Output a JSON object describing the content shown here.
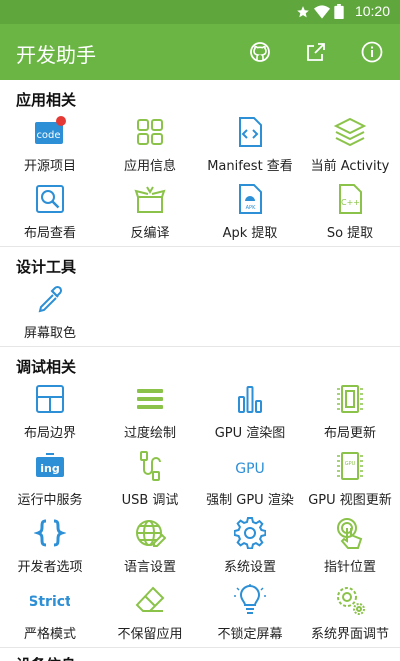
{
  "status": {
    "time": "10:20"
  },
  "app": {
    "title": "开发助手"
  },
  "sections": {
    "app_related": {
      "title": "应用相关",
      "items": [
        "开源项目",
        "应用信息",
        "Manifest 查看",
        "当前 Activity",
        "布局查看",
        "反编译",
        "Apk 提取",
        "So 提取"
      ]
    },
    "design_tools": {
      "title": "设计工具",
      "items": [
        "屏幕取色"
      ]
    },
    "debug_related": {
      "title": "调试相关",
      "items": [
        "布局边界",
        "过度绘制",
        "GPU 渲染图",
        "布局更新",
        "运行中服务",
        "USB 调试",
        "强制 GPU 渲染",
        "GPU 视图更新",
        "开发者选项",
        "语言设置",
        "系统设置",
        "指针位置",
        "严格模式",
        "不保留应用",
        "不锁定屏幕",
        "系统界面调节"
      ]
    },
    "device_info": {
      "title": "设备信息"
    }
  },
  "icon_text": {
    "code": "code",
    "apk": "APK",
    "cpp": "C++",
    "ing": "ing",
    "gpu": "GPU",
    "strict": "Strict"
  },
  "colors": {
    "statusbar": "#5fa73d",
    "appbar": "#6ab543",
    "accent_blue": "#2d8fd5",
    "accent_green": "#8bc34a",
    "badge_red": "#e53935"
  }
}
